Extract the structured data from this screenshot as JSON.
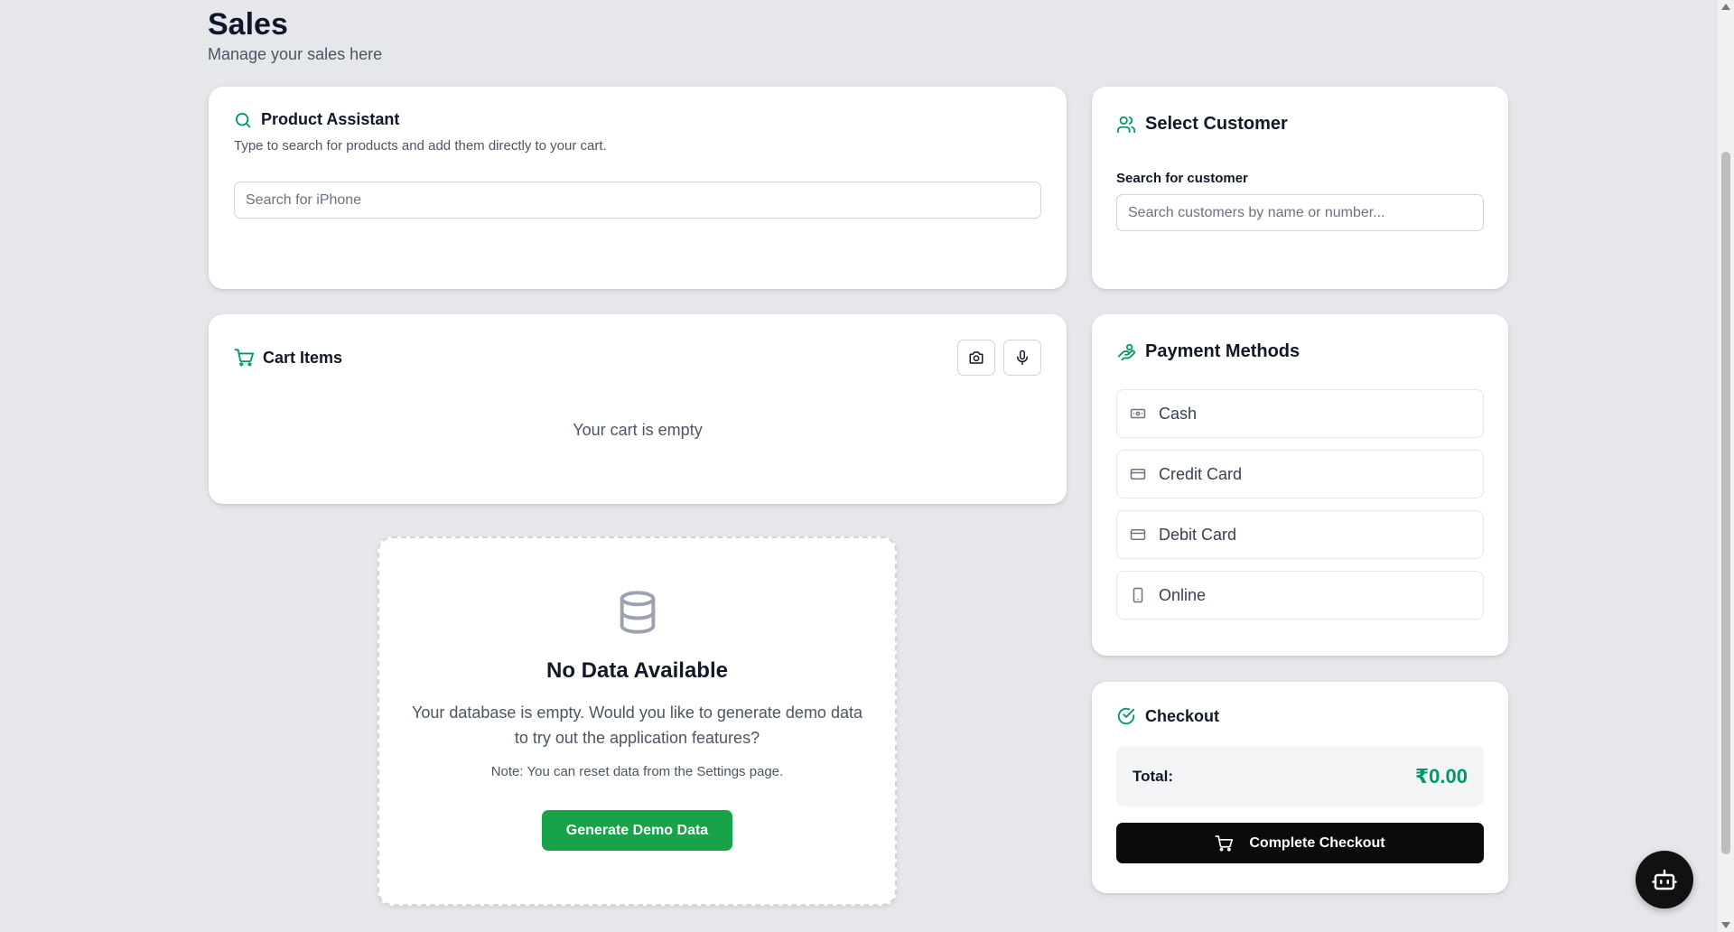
{
  "page": {
    "title": "Sales",
    "subtitle": "Manage your sales here"
  },
  "product_assistant": {
    "title": "Product Assistant",
    "description": "Type to search for products and add them directly to your cart.",
    "search_placeholder": "Search for iPhone",
    "search_value": "",
    "icon": "search-icon"
  },
  "customer": {
    "title": "Select Customer",
    "search_label": "Search for customer",
    "search_placeholder": "Search customers by name or number...",
    "search_value": "",
    "icon": "users-icon"
  },
  "cart": {
    "title": "Cart Items",
    "empty_text": "Your cart is empty",
    "actions": [
      "camera-icon",
      "microphone-icon"
    ],
    "icon": "cart-icon"
  },
  "payment": {
    "title": "Payment Methods",
    "icon": "payment-hand-icon",
    "methods": [
      {
        "label": "Cash",
        "icon": "banknote-icon"
      },
      {
        "label": "Credit Card",
        "icon": "credit-card-icon"
      },
      {
        "label": "Debit Card",
        "icon": "debit-card-icon"
      },
      {
        "label": "Online",
        "icon": "smartphone-icon"
      }
    ]
  },
  "checkout": {
    "title": "Checkout",
    "total_label": "Total:",
    "total_value": "₹0.00",
    "button_label": "Complete Checkout",
    "icon": "check-circle-icon"
  },
  "no_data": {
    "title": "No Data Available",
    "message": "Your database is empty. Would you like to generate demo data to try out the application features?",
    "note": "Note: You can reset data from the Settings page.",
    "button_label": "Generate Demo Data",
    "icon": "database-icon"
  },
  "fab": {
    "icon": "bot-icon"
  },
  "colors": {
    "accent_green": "#059669",
    "button_green": "#16a34a",
    "background": "#e5e7eb",
    "dark_button": "#0b0b0b"
  }
}
